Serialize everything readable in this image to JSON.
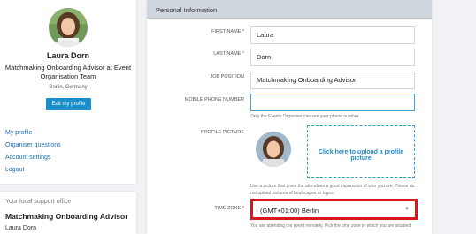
{
  "profile": {
    "name": "Laura Dorn",
    "role": "Matchmaking Onboarding Advisor at Event Organisation Team",
    "location": "Berlin, Germany",
    "edit_button": "Edit my profile"
  },
  "nav": {
    "my_profile": "My profile",
    "organiser_questions": "Organiser questions",
    "account_settings": "Account settings",
    "logout": "Logout"
  },
  "support": {
    "title": "Your local support office",
    "name": "Matchmaking Onboarding Advisor",
    "person": "Laura Dorn"
  },
  "form": {
    "section_title": "Personal Information",
    "first_name": {
      "label": "FIRST NAME",
      "value": "Laura"
    },
    "last_name": {
      "label": "LAST NAME",
      "value": "Dorn"
    },
    "job_position": {
      "label": "JOB POSITION",
      "value": "Matchmaking Onboarding Advisor"
    },
    "mobile": {
      "label": "MOBILE PHONE NUMBER",
      "value": "",
      "help": "Only the Events Organiser can see your phone number"
    },
    "picture": {
      "label": "PROFILE PICTURE",
      "upload_text": "Click here to upload a profile picture",
      "help": "Use a picture that gives the attendees a good impression of who you are. Please do not upload pictures of landscapes or logos."
    },
    "timezone": {
      "label": "TIME ZONE",
      "value": "(GMT+01:00) Berlin",
      "help": "You are attending the event remotely. Pick the time zone in which you are situated"
    },
    "required_mark": "*"
  },
  "colors": {
    "accent": "#1a8fc9",
    "highlight": "#d8171a",
    "link": "#1f6fb0"
  },
  "icons": {
    "dropdown": "chevron-down-icon"
  }
}
